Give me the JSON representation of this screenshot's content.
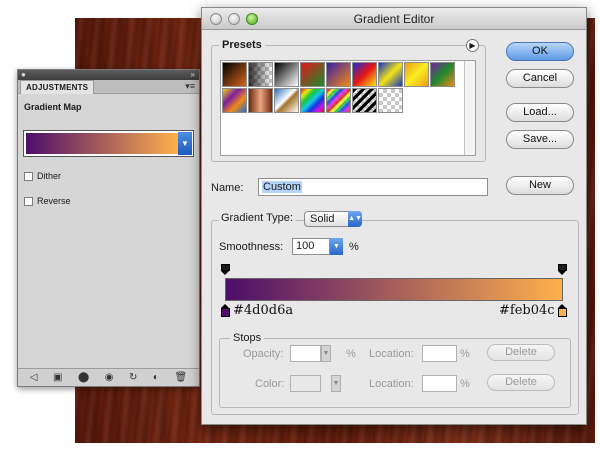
{
  "adjustments_panel": {
    "tab_label": "ADJUSTMENTS",
    "title": "Gradient Map",
    "gradient": {
      "start_color": "#4d0d6a",
      "end_color": "#feb04c"
    },
    "dither_label": "Dither",
    "reverse_label": "Reverse",
    "footer_icons": [
      "back-arrow-icon",
      "layers-icon",
      "circle-icon",
      "eye-icon",
      "refresh-icon",
      "reset-icon",
      "trash-icon"
    ]
  },
  "gradient_editor": {
    "title": "Gradient Editor",
    "presets_label": "Presets",
    "presets": [
      "orange-black",
      "checker-fade",
      "black-white",
      "red-green",
      "violet-orange",
      "blue-red-yellow",
      "blue-yellow-blue",
      "orange-yellow-orange",
      "violet-green-orange",
      "yellow-violet-orange-blue",
      "copper",
      "chrome",
      "spectrum",
      "transparent-rainbow",
      "transparent-stripes",
      "transparent"
    ],
    "buttons": {
      "ok": "OK",
      "cancel": "Cancel",
      "load": "Load...",
      "save": "Save...",
      "new": "New"
    },
    "name_label": "Name:",
    "name_value": "Custom",
    "gradient_type_label": "Gradient Type:",
    "gradient_type_value": "Solid",
    "smoothness_label": "Smoothness:",
    "smoothness_value": "100",
    "percent": "%",
    "color_stops": {
      "left_hex": "#4d0d6a",
      "right_hex": "#feb04c"
    },
    "stops": {
      "label": "Stops",
      "opacity_label": "Opacity:",
      "color_label": "Color:",
      "location_label": "Location:",
      "delete_label": "Delete"
    }
  },
  "colors": {
    "accent_blue": "#5e9ae5",
    "gradient_start": "#4d0d6a",
    "gradient_end": "#feb04c"
  }
}
